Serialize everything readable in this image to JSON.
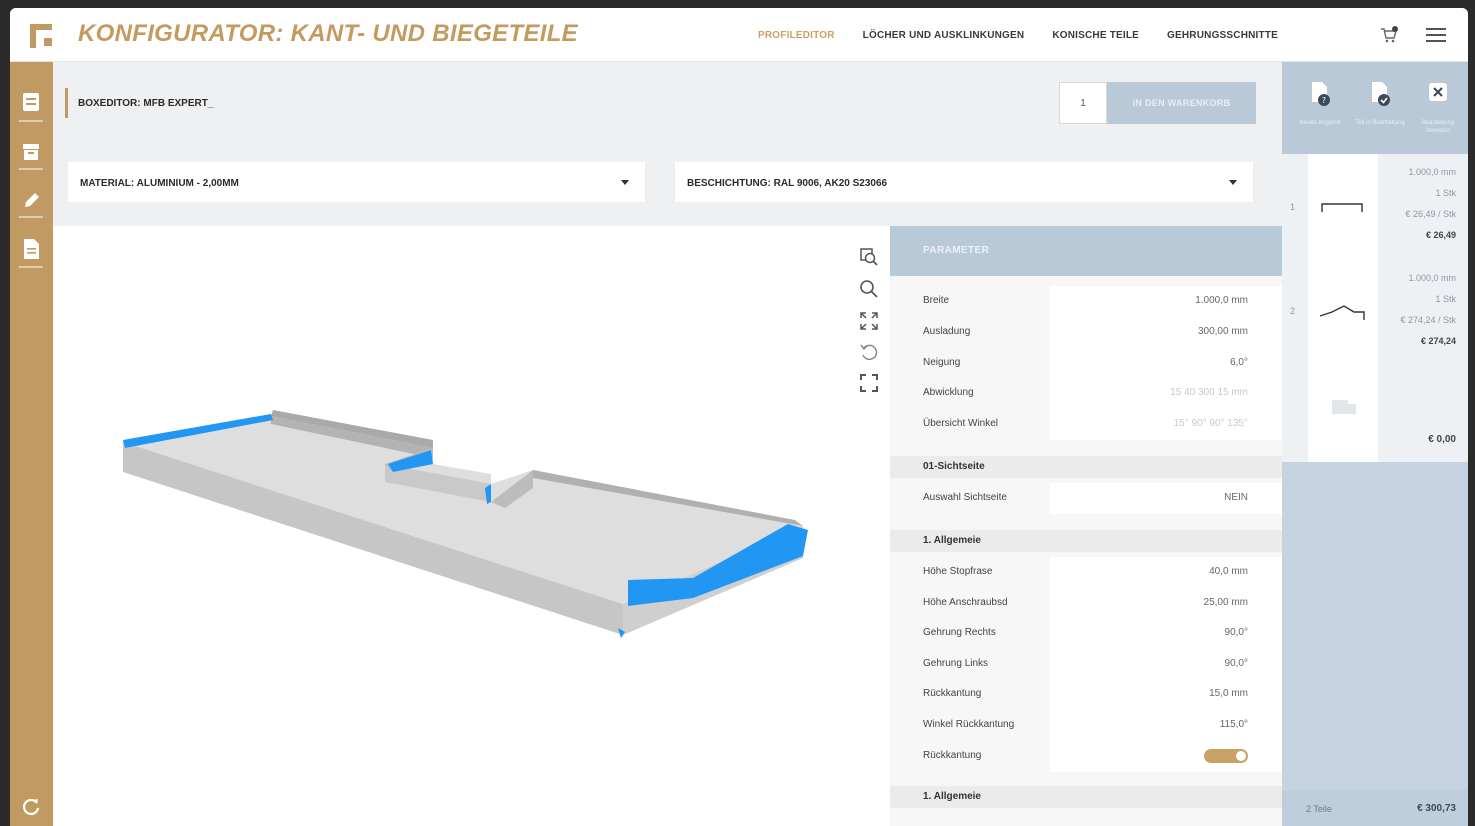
{
  "header": {
    "title": "KONFIGURATOR: KANT- UND BIEGETEILE",
    "nav": [
      {
        "label": "PROFILEDITOR",
        "active": true
      },
      {
        "label": "LÖCHER UND AUSKLINKUNGEN",
        "active": false
      },
      {
        "label": "KONISCHE TEILE",
        "active": false
      },
      {
        "label": "GEHRUNGSSCHNITTE",
        "active": false
      }
    ],
    "cart_count": "0"
  },
  "toolbar": {
    "breadcrumb": "BOXEDITOR: MFB EXPERT_",
    "quantity": "1",
    "add_button": "IN DEN WARENKORB"
  },
  "dropdowns": {
    "material": "MATERIAL: ALUMINIUM - 2,00MM",
    "coating": "BESCHICHTUNG: RAL 9006, AK20 S23066"
  },
  "params": {
    "header": "PARAMETER",
    "rows_top": [
      {
        "label": "Breite",
        "value": "1.000,0 mm"
      },
      {
        "label": "Ausladung",
        "value": "300,00 mm"
      },
      {
        "label": "Neigung",
        "value": "6,0°"
      },
      {
        "label": "Abwicklung",
        "value": "15 40 300 15 mm"
      },
      {
        "label": "Übersicht Winkel",
        "value": "15° 90° 90° 135°"
      }
    ],
    "section1": "01-Sichtseite",
    "rows_mid": [
      {
        "label": "Auswahl Sichtseite",
        "value": "NEIN"
      }
    ],
    "section2": "1. Allgemeie",
    "rows_bottom": [
      {
        "label": "Höhe Stopfrase",
        "value": "40,0 mm"
      },
      {
        "label": "Höhe Anschraubsd",
        "value": "25,00 mm"
      },
      {
        "label": "Gehrung Rechts",
        "value": "90,0°"
      },
      {
        "label": "Gehrung Links",
        "value": "90,0°"
      },
      {
        "label": "Rückkantung",
        "value": "15,0 mm"
      },
      {
        "label": "Winkel Rückkantung",
        "value": "115,0°"
      },
      {
        "label": "Rückkantung",
        "value": ""
      }
    ],
    "section3": "1. Allgemeie"
  },
  "right_panel": {
    "actions": [
      {
        "caption": "Neues Angebot",
        "icon": "file-question-icon"
      },
      {
        "caption": "Teil in Bearbeitung",
        "icon": "file-check-icon"
      },
      {
        "caption": "Bearbeitung beenden",
        "icon": "close-icon"
      }
    ],
    "items": [
      {
        "num": "1",
        "length": "1.000,0 mm",
        "qty": "1 Stk",
        "unit": "€ 26,49 / Stk",
        "total": "€ 26,49"
      },
      {
        "num": "2",
        "length": "1.000,0 mm",
        "qty": "1 Stk",
        "unit": "€ 274,24 / Stk",
        "total": "€ 274,24"
      }
    ],
    "empty_total": "€ 0,00",
    "footer_count": "2 Teile",
    "footer_total": "€ 300,73"
  },
  "colors": {
    "accent": "#c19a63",
    "highlight": "#2196f3",
    "panel": "#b8c9d8"
  }
}
